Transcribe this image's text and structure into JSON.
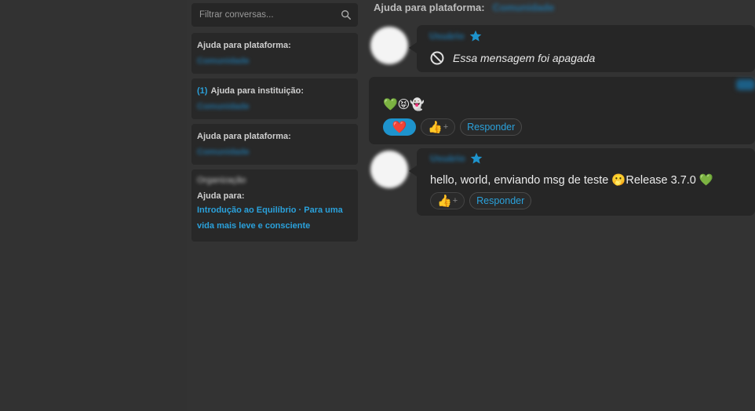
{
  "search": {
    "placeholder": "Filtrar conversas..."
  },
  "conversations": [
    {
      "title": "Ajuda para plataforma:",
      "subtitle": "Comunidade"
    },
    {
      "count": "(1)",
      "title": "Ajuda para instituição:",
      "subtitle": "Comunidade"
    },
    {
      "title": "Ajuda para plataforma:",
      "subtitle": "Comunidade"
    },
    {
      "name": "Organização",
      "title": "Ajuda para:",
      "link_line1": "Introdução ao Equilíbrio · Para uma",
      "link_line2": "vida mais leve e consciente"
    }
  ],
  "header": {
    "title": "Ajuda para plataforma:",
    "blurred": "Comunidade"
  },
  "messages": [
    {
      "author": "Usuário",
      "deleted_text": "Essa mensagem foi apagada"
    },
    {
      "text": "💚😝👻",
      "reaction": "❤️",
      "add_reaction": "👍",
      "plus": "+",
      "reply": "Responder"
    },
    {
      "author": "Usuário",
      "text": "hello, world, enviando msg de teste 🫢Release 3.7.0 💚",
      "add_reaction": "👍",
      "plus": "+",
      "reply": "Responder"
    }
  ],
  "colors": {
    "accent": "#2aa1db",
    "background": "#333333",
    "card": "#282828"
  }
}
